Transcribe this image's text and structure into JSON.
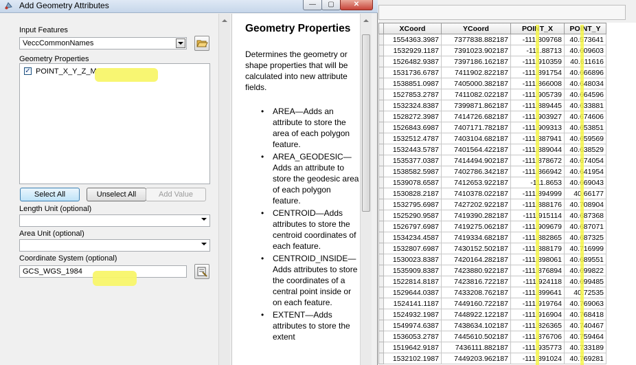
{
  "window": {
    "title": "Add Geometry Attributes",
    "minimize": "—",
    "maximize": "▢",
    "close": "✕"
  },
  "form": {
    "input_features_label": "Input Features",
    "input_features_value": "VeccCommonNames",
    "geometry_properties_label": "Geometry Properties",
    "geometry_items": [
      {
        "label": "POINT_X_Y_Z_M",
        "checked": true
      }
    ],
    "select_all": "Select All",
    "unselect_all": "Unselect All",
    "add_value": "Add Value",
    "length_unit_label": "Length Unit (optional)",
    "length_unit_value": "",
    "area_unit_label": "Area Unit (optional)",
    "area_unit_value": "",
    "coordinate_system_label": "Coordinate System (optional)",
    "coordinate_system_value": "GCS_WGS_1984"
  },
  "help": {
    "title": "Geometry Properties",
    "intro": "Determines the geometry or shape properties that will be calculated into new attribute fields.",
    "items": [
      "AREA—Adds an attribute to store the area of each polygon feature.",
      "AREA_GEODESIC—Adds an attribute to store the geodesic area of each polygon feature.",
      "CENTROID—Adds attributes to store the centroid coordinates of each feature.",
      "CENTROID_INSIDE—Adds attributes to store the coordinates of a central point inside or on each feature.",
      "EXTENT—Adds attributes to store the extent"
    ]
  },
  "table": {
    "columns": [
      "XCoord",
      "YCoord",
      "POINT_X",
      "POINT_Y"
    ],
    "rows": [
      [
        "1554363.3987",
        "7377838.882187",
        "-111.809768",
        "40.573641"
      ],
      [
        "1532929.1187",
        "7391023.902187",
        "-111.88713",
        "40.609603"
      ],
      [
        "1526482.9387",
        "7397186.162187",
        "-111.910359",
        "40.611616"
      ],
      [
        "1531736.6787",
        "7411902.822187",
        "-111.891754",
        "40.666896"
      ],
      [
        "1538851.0987",
        "7405000.382187",
        "-111.866008",
        "40.648034"
      ],
      [
        "1527853.2787",
        "7411082.022187",
        "-111.905739",
        "40.664596"
      ],
      [
        "1532324.8387",
        "7399871.862187",
        "-111.889445",
        "40.633881"
      ],
      [
        "1528272.3987",
        "7414726.682187",
        "-111.903927",
        "40.674606"
      ],
      [
        "1526843.6987",
        "7407171.782187",
        "-111.909313",
        "40.653851"
      ],
      [
        "1532512.4787",
        "7403104.682187",
        "-111.887941",
        "40.659569"
      ],
      [
        "1532443.5787",
        "7401564.422187",
        "-111.889044",
        "40.638529"
      ],
      [
        "1535377.0387",
        "7414494.902187",
        "-111.878672",
        "40.674054"
      ],
      [
        "1538582.5987",
        "7402786.342187",
        "-111.866942",
        "40.641954"
      ],
      [
        "1539078.6587",
        "7412653.922187",
        "-111.8653",
        "40.669043"
      ],
      [
        "1530828.2187",
        "7410378.022187",
        "-111.894999",
        "40.66177"
      ],
      [
        "1532795.6987",
        "7427202.922187",
        "-111.888176",
        "40.708904"
      ],
      [
        "1525290.9587",
        "7419390.282187",
        "-111.915114",
        "40.687368"
      ],
      [
        "1526797.6987",
        "7419275.062187",
        "-111.909679",
        "40.687071"
      ],
      [
        "1534234.4587",
        "7419334.682187",
        "-111.882865",
        "40.687325"
      ],
      [
        "1532807.6987",
        "7430152.502187",
        "-111.888179",
        "40.716999"
      ],
      [
        "1530023.8387",
        "7420164.282187",
        "-111.898061",
        "40.689551"
      ],
      [
        "1535909.8387",
        "7423880.922187",
        "-111.876894",
        "40.699822"
      ],
      [
        "1522814.8187",
        "7423816.722187",
        "-111.924118",
        "40.699485"
      ],
      [
        "1529644.0387",
        "7433208.762187",
        "-111.899641",
        "40.72535"
      ],
      [
        "1524141.1187",
        "7449160.722187",
        "-111.919764",
        "40.769063"
      ],
      [
        "1524932.1987",
        "7448922.122187",
        "-111.916904",
        "40.768418"
      ],
      [
        "1549974.6387",
        "7438634.102187",
        "-111.826365",
        "40.740467"
      ],
      [
        "1536053.2787",
        "7445610.502187",
        "-111.876706",
        "40.759464"
      ],
      [
        "1519642.9187",
        "7436111.882187",
        "-111.935773",
        "40.733189"
      ],
      [
        "1532102.1987",
        "7449203.962187",
        "-111.891024",
        "40.769281"
      ]
    ]
  },
  "icons": {
    "app": "arcgis-tool-icon",
    "browse": "folder-open-icon",
    "coordinate_browse": "properties-icon"
  },
  "colors": {
    "highlight": "#f8f56a",
    "title_bar": "#c6d6ea",
    "close_button": "#c7443a"
  }
}
